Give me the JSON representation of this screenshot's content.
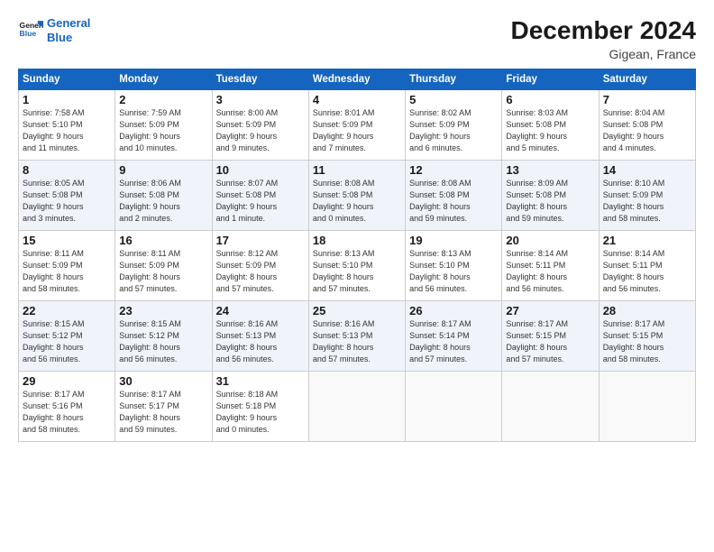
{
  "logo": {
    "line1": "General",
    "line2": "Blue"
  },
  "title": "December 2024",
  "subtitle": "Gigean, France",
  "headers": [
    "Sunday",
    "Monday",
    "Tuesday",
    "Wednesday",
    "Thursday",
    "Friday",
    "Saturday"
  ],
  "weeks": [
    [
      {
        "day": "1",
        "info": "Sunrise: 7:58 AM\nSunset: 5:10 PM\nDaylight: 9 hours\nand 11 minutes."
      },
      {
        "day": "2",
        "info": "Sunrise: 7:59 AM\nSunset: 5:09 PM\nDaylight: 9 hours\nand 10 minutes."
      },
      {
        "day": "3",
        "info": "Sunrise: 8:00 AM\nSunset: 5:09 PM\nDaylight: 9 hours\nand 9 minutes."
      },
      {
        "day": "4",
        "info": "Sunrise: 8:01 AM\nSunset: 5:09 PM\nDaylight: 9 hours\nand 7 minutes."
      },
      {
        "day": "5",
        "info": "Sunrise: 8:02 AM\nSunset: 5:09 PM\nDaylight: 9 hours\nand 6 minutes."
      },
      {
        "day": "6",
        "info": "Sunrise: 8:03 AM\nSunset: 5:08 PM\nDaylight: 9 hours\nand 5 minutes."
      },
      {
        "day": "7",
        "info": "Sunrise: 8:04 AM\nSunset: 5:08 PM\nDaylight: 9 hours\nand 4 minutes."
      }
    ],
    [
      {
        "day": "8",
        "info": "Sunrise: 8:05 AM\nSunset: 5:08 PM\nDaylight: 9 hours\nand 3 minutes."
      },
      {
        "day": "9",
        "info": "Sunrise: 8:06 AM\nSunset: 5:08 PM\nDaylight: 9 hours\nand 2 minutes."
      },
      {
        "day": "10",
        "info": "Sunrise: 8:07 AM\nSunset: 5:08 PM\nDaylight: 9 hours\nand 1 minute."
      },
      {
        "day": "11",
        "info": "Sunrise: 8:08 AM\nSunset: 5:08 PM\nDaylight: 9 hours\nand 0 minutes."
      },
      {
        "day": "12",
        "info": "Sunrise: 8:08 AM\nSunset: 5:08 PM\nDaylight: 8 hours\nand 59 minutes."
      },
      {
        "day": "13",
        "info": "Sunrise: 8:09 AM\nSunset: 5:08 PM\nDaylight: 8 hours\nand 59 minutes."
      },
      {
        "day": "14",
        "info": "Sunrise: 8:10 AM\nSunset: 5:09 PM\nDaylight: 8 hours\nand 58 minutes."
      }
    ],
    [
      {
        "day": "15",
        "info": "Sunrise: 8:11 AM\nSunset: 5:09 PM\nDaylight: 8 hours\nand 58 minutes."
      },
      {
        "day": "16",
        "info": "Sunrise: 8:11 AM\nSunset: 5:09 PM\nDaylight: 8 hours\nand 57 minutes."
      },
      {
        "day": "17",
        "info": "Sunrise: 8:12 AM\nSunset: 5:09 PM\nDaylight: 8 hours\nand 57 minutes."
      },
      {
        "day": "18",
        "info": "Sunrise: 8:13 AM\nSunset: 5:10 PM\nDaylight: 8 hours\nand 57 minutes."
      },
      {
        "day": "19",
        "info": "Sunrise: 8:13 AM\nSunset: 5:10 PM\nDaylight: 8 hours\nand 56 minutes."
      },
      {
        "day": "20",
        "info": "Sunrise: 8:14 AM\nSunset: 5:11 PM\nDaylight: 8 hours\nand 56 minutes."
      },
      {
        "day": "21",
        "info": "Sunrise: 8:14 AM\nSunset: 5:11 PM\nDaylight: 8 hours\nand 56 minutes."
      }
    ],
    [
      {
        "day": "22",
        "info": "Sunrise: 8:15 AM\nSunset: 5:12 PM\nDaylight: 8 hours\nand 56 minutes."
      },
      {
        "day": "23",
        "info": "Sunrise: 8:15 AM\nSunset: 5:12 PM\nDaylight: 8 hours\nand 56 minutes."
      },
      {
        "day": "24",
        "info": "Sunrise: 8:16 AM\nSunset: 5:13 PM\nDaylight: 8 hours\nand 56 minutes."
      },
      {
        "day": "25",
        "info": "Sunrise: 8:16 AM\nSunset: 5:13 PM\nDaylight: 8 hours\nand 57 minutes."
      },
      {
        "day": "26",
        "info": "Sunrise: 8:17 AM\nSunset: 5:14 PM\nDaylight: 8 hours\nand 57 minutes."
      },
      {
        "day": "27",
        "info": "Sunrise: 8:17 AM\nSunset: 5:15 PM\nDaylight: 8 hours\nand 57 minutes."
      },
      {
        "day": "28",
        "info": "Sunrise: 8:17 AM\nSunset: 5:15 PM\nDaylight: 8 hours\nand 58 minutes."
      }
    ],
    [
      {
        "day": "29",
        "info": "Sunrise: 8:17 AM\nSunset: 5:16 PM\nDaylight: 8 hours\nand 58 minutes."
      },
      {
        "day": "30",
        "info": "Sunrise: 8:17 AM\nSunset: 5:17 PM\nDaylight: 8 hours\nand 59 minutes."
      },
      {
        "day": "31",
        "info": "Sunrise: 8:18 AM\nSunset: 5:18 PM\nDaylight: 9 hours\nand 0 minutes."
      },
      {
        "day": "",
        "info": ""
      },
      {
        "day": "",
        "info": ""
      },
      {
        "day": "",
        "info": ""
      },
      {
        "day": "",
        "info": ""
      }
    ]
  ]
}
